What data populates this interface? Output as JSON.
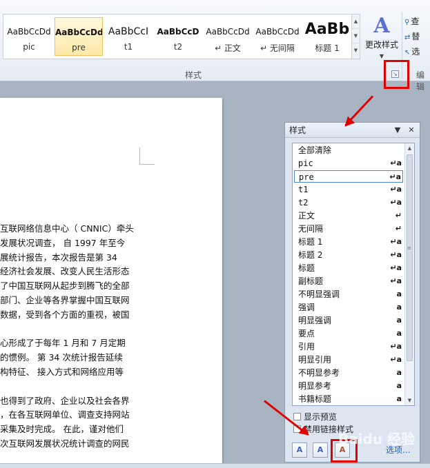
{
  "ribbon": {
    "styles_gallery": [
      {
        "sample": "AaBbCcDd",
        "name": "pic"
      },
      {
        "sample": "AaBbCcDd",
        "name": "pre",
        "selected": true
      },
      {
        "sample": "AaBbCcI",
        "name": "t1"
      },
      {
        "sample": "AaBbCcD",
        "name": "t2"
      },
      {
        "sample": "AaBbCcDd",
        "name": "↵ 正文"
      },
      {
        "sample": "AaBbCcDd",
        "name": "↵ 无间隔"
      },
      {
        "sample": "AaBb",
        "name": "标题 1"
      }
    ],
    "change_styles_label": "更改样式",
    "edit_items": [
      "查",
      "替",
      "选"
    ],
    "group_label_styles": "样式",
    "group_label_edit": "编辑"
  },
  "document": {
    "lines": [
      "互联网络信息中心（ CNNIC）牵头",
      "发展状况调查， 自 1997 年至今",
      "展统计报告，本次报告是第 34",
      "经济社会发展、改变人民生活形态",
      "了中国互联网从起步到腾飞的全部",
      "部门、企业等各界掌握中国互联网",
      "数据，受到各个方面的重视，被国",
      "",
      "心形成了于每年 1 月和 7 月定期",
      "的惯例。 第 34 次统计报告延续",
      "构特征、 接入方式和网络应用等",
      "",
      "也得到了政府、企业以及社会各界",
      "，在各互联网单位、调查支持网站",
      "采集及时完成。 在此，谨对他们",
      "次互联网发展状况统计调查的网民"
    ]
  },
  "styles_pane": {
    "title": "样式",
    "items": [
      {
        "name": "全部清除",
        "mark": ""
      },
      {
        "name": "pic",
        "mark": "↵a"
      },
      {
        "name": "pre",
        "mark": "↵a",
        "selected": true
      },
      {
        "name": "t1",
        "mark": "↵a"
      },
      {
        "name": "t2",
        "mark": "↵a"
      },
      {
        "name": "正文",
        "mark": "↵"
      },
      {
        "name": "无间隔",
        "mark": "↵"
      },
      {
        "name": "标题 1",
        "mark": "↵a"
      },
      {
        "name": "标题 2",
        "mark": "↵a"
      },
      {
        "name": "标题",
        "mark": "↵a"
      },
      {
        "name": "副标题",
        "mark": "↵a"
      },
      {
        "name": "不明显强调",
        "mark": "a"
      },
      {
        "name": "强调",
        "mark": "a"
      },
      {
        "name": "明显强调",
        "mark": "a"
      },
      {
        "name": "要点",
        "mark": "a"
      },
      {
        "name": "引用",
        "mark": "↵a"
      },
      {
        "name": "明显引用",
        "mark": "↵a"
      },
      {
        "name": "不明显参考",
        "mark": "a"
      },
      {
        "name": "明显参考",
        "mark": "a"
      },
      {
        "name": "书籍标题",
        "mark": "a"
      }
    ],
    "show_preview_label": "显示预览",
    "disable_linked_label": "禁用链接样式",
    "options_label": "选项...",
    "show_preview_checked": false,
    "disable_linked_checked": false
  },
  "annotation": {
    "color": "#e00000"
  },
  "watermark": "Baidu 经验"
}
